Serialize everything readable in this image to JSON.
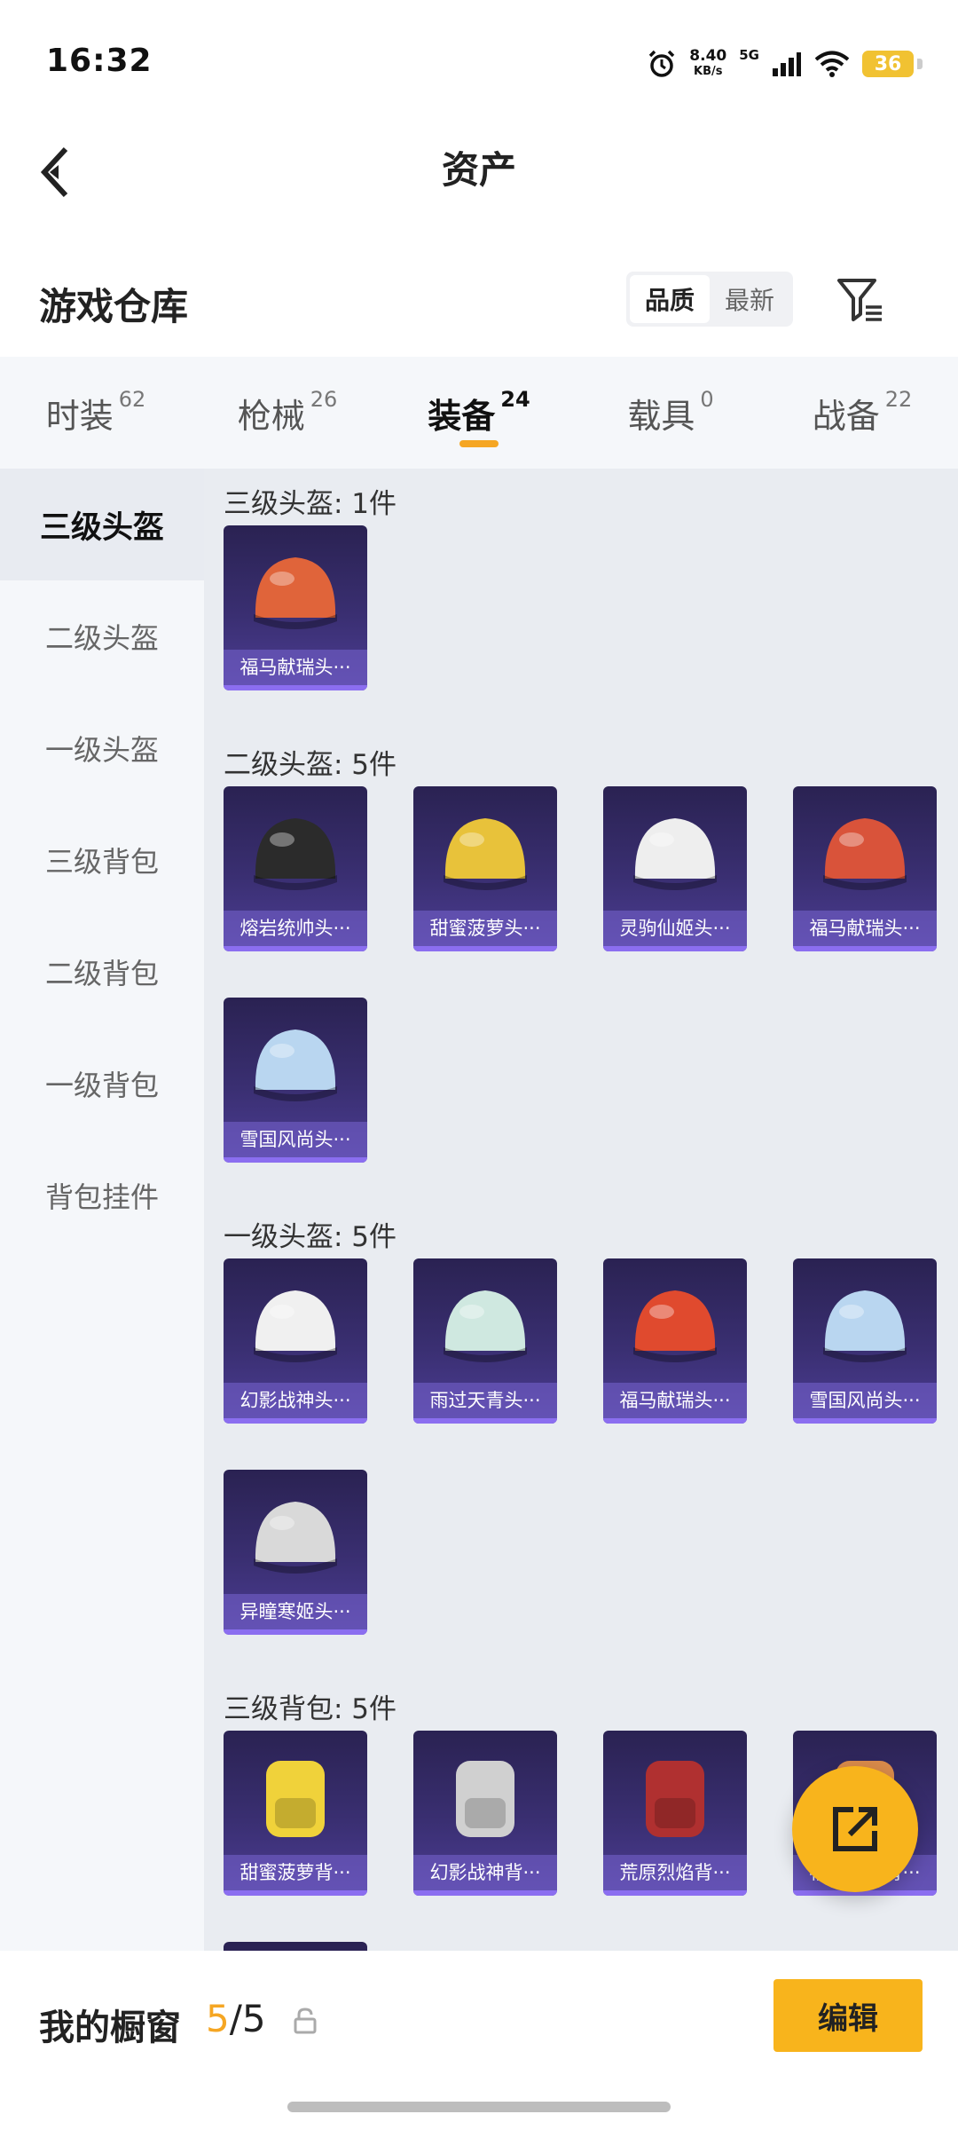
{
  "status": {
    "time": "16:32",
    "net_speed_value": "8.40",
    "net_speed_unit": "KB/s",
    "signal_label": "5G",
    "battery": "36"
  },
  "nav": {
    "title": "资产"
  },
  "warehouse": {
    "title": "游戏仓库",
    "sort_options": [
      "品质",
      "最新"
    ],
    "sort_selected": "品质"
  },
  "tabs": [
    {
      "label": "时装",
      "count": "62"
    },
    {
      "label": "枪械",
      "count": "26"
    },
    {
      "label": "装备",
      "count": "24"
    },
    {
      "label": "载具",
      "count": "0"
    },
    {
      "label": "战备",
      "count": "22"
    }
  ],
  "active_tab": "装备",
  "sidebar": {
    "items": [
      {
        "label": "三级头盔"
      },
      {
        "label": "二级头盔"
      },
      {
        "label": "一级头盔"
      },
      {
        "label": "三级背包"
      },
      {
        "label": "二级背包"
      },
      {
        "label": "一级背包"
      },
      {
        "label": "背包挂件"
      }
    ],
    "active": "三级头盔"
  },
  "groups": [
    {
      "title": "三级头盔: 1件",
      "items": [
        {
          "name": "福马献瑞头···",
          "icon": "helmet-horse-icon",
          "color": "#e0643a"
        }
      ]
    },
    {
      "title": "二级头盔: 5件",
      "items": [
        {
          "name": "熔岩统帅头···",
          "icon": "helmet-lava-icon",
          "color": "#2b2b2b"
        },
        {
          "name": "甜蜜菠萝头···",
          "icon": "helmet-pineapple-icon",
          "color": "#e8c23a"
        },
        {
          "name": "灵驹仙姬头···",
          "icon": "helmet-white-horse-icon",
          "color": "#eeeeee"
        },
        {
          "name": "福马献瑞头···",
          "icon": "helmet-red-icon",
          "color": "#d9533a"
        },
        {
          "name": "雪国风尚头···",
          "icon": "helmet-snow-icon",
          "color": "#b9d6f0"
        }
      ]
    },
    {
      "title": "一级头盔: 5件",
      "items": [
        {
          "name": "幻影战神头···",
          "icon": "helmet-phantom-icon",
          "color": "#f0f0f0"
        },
        {
          "name": "雨过天青头···",
          "icon": "helmet-celadon-icon",
          "color": "#cfe8e0"
        },
        {
          "name": "福马献瑞头···",
          "icon": "helmet-red-icon",
          "color": "#e04a2e"
        },
        {
          "name": "雪国风尚头···",
          "icon": "helmet-snow-icon",
          "color": "#b9d6f0"
        },
        {
          "name": "异瞳寒姬头···",
          "icon": "helmet-cyber-icon",
          "color": "#d9d9d9"
        }
      ]
    },
    {
      "title": "三级背包: 5件",
      "items": [
        {
          "name": "甜蜜菠萝背···",
          "icon": "backpack-pineapple-icon",
          "color": "#f0d23a"
        },
        {
          "name": "幻影战神背···",
          "icon": "backpack-phantom-icon",
          "color": "#d0d0d0"
        },
        {
          "name": "荒原烈焰背···",
          "icon": "backpack-flame-icon",
          "color": "#b03030"
        },
        {
          "name": "福马献瑞背···",
          "icon": "backpack-horse-icon",
          "color": "#d98a4a"
        },
        {
          "name": "",
          "icon": "backpack-dark-icon",
          "color": "#2a2252"
        }
      ]
    }
  ],
  "bottom": {
    "label": "我的橱窗",
    "count_current": "5",
    "count_sep_total": "/5",
    "edit_label": "编辑"
  },
  "colors": {
    "accent": "#f5a623",
    "button": "#f8b41c",
    "card_bg": "#2a2252",
    "content_bg": "#e9ecf1"
  }
}
